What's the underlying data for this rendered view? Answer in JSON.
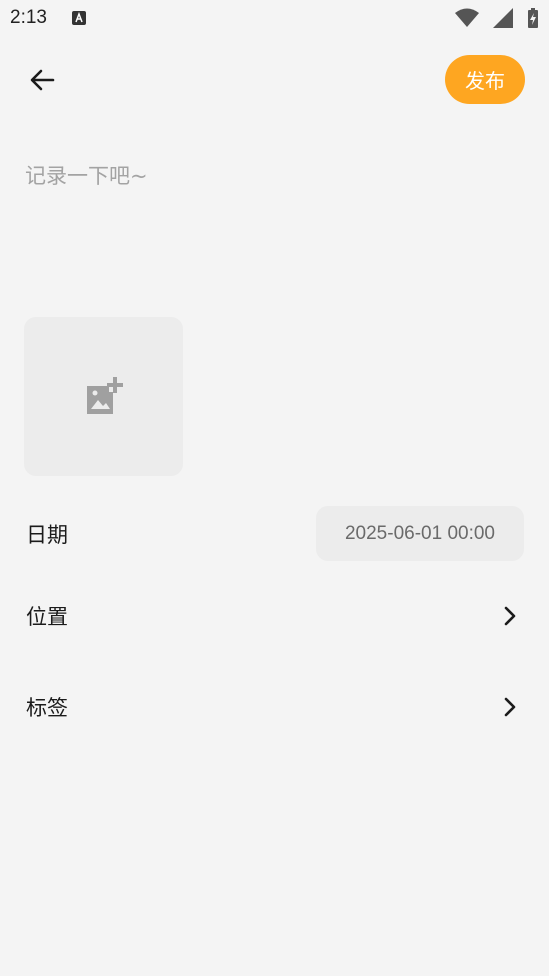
{
  "status_bar": {
    "time": "2:13",
    "icons": [
      "keyboard-a-icon",
      "wifi-icon",
      "signal-icon",
      "battery-charging-icon"
    ]
  },
  "header": {
    "back_icon": "arrow-left-icon",
    "publish_label": "发布",
    "publish_color": "#fea621"
  },
  "editor": {
    "placeholder": "记录一下吧~",
    "value": ""
  },
  "media": {
    "add_image_icon": "add-photo-icon"
  },
  "fields": {
    "date_label": "日期",
    "date_value": "2025-06-01 00:00",
    "location_label": "位置",
    "tags_label": "标签"
  },
  "colors": {
    "background": "#f4f4f4",
    "accent": "#fea621",
    "tile": "#ececec"
  }
}
